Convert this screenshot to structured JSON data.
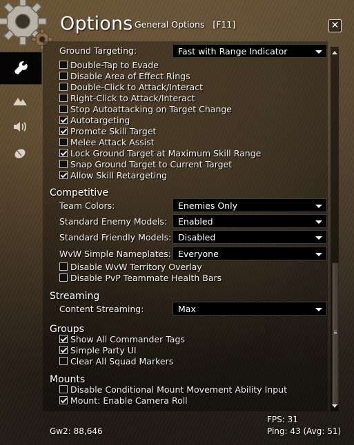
{
  "header": {
    "title": "Options",
    "subtitle": "General Options   [F11]",
    "close_icon": "close-icon"
  },
  "tabs": [
    {
      "icon": "wrench-icon",
      "active": true
    },
    {
      "icon": "mountains-icon",
      "active": false
    },
    {
      "icon": "speaker-icon",
      "active": false
    },
    {
      "icon": "mouse-icon",
      "active": false
    }
  ],
  "ground_targeting": {
    "label": "Ground Targeting:",
    "value": "Fast with Range Indicator"
  },
  "combat_options": [
    {
      "label": "Double-Tap to Evade",
      "checked": false
    },
    {
      "label": "Disable Area of Effect Rings",
      "checked": false
    },
    {
      "label": "Double-Click to Attack/Interact",
      "checked": false
    },
    {
      "label": "Right-Click to Attack/Interact",
      "checked": false
    },
    {
      "label": "Stop Autoattacking on Target Change",
      "checked": false
    },
    {
      "label": "Autotargeting",
      "checked": true
    },
    {
      "label": "Promote Skill Target",
      "checked": true
    },
    {
      "label": "Melee Attack Assist",
      "checked": false
    },
    {
      "label": "Lock Ground Target at Maximum Skill Range",
      "checked": true
    },
    {
      "label": "Snap Ground Target to Current Target",
      "checked": false
    },
    {
      "label": "Allow Skill Retargeting",
      "checked": true
    }
  ],
  "competitive": {
    "heading": "Competitive",
    "dropdowns": [
      {
        "label": "Team Colors:",
        "value": "Enemies Only"
      },
      {
        "label": "Standard Enemy Models:",
        "value": "Enabled"
      },
      {
        "label": "Standard Friendly Models:",
        "value": "Disabled"
      },
      {
        "label": "WvW Simple Nameplates:",
        "value": "Everyone"
      }
    ],
    "checkboxes": [
      {
        "label": "Disable WvW Territory Overlay",
        "checked": false
      },
      {
        "label": "Disable PvP Teammate Health Bars",
        "checked": false
      }
    ]
  },
  "streaming": {
    "heading": "Streaming",
    "dropdown": {
      "label": "Content Streaming:",
      "value": "Max"
    }
  },
  "groups": {
    "heading": "Groups",
    "checkboxes": [
      {
        "label": "Show All Commander Tags",
        "checked": true
      },
      {
        "label": "Simple Party UI",
        "checked": true
      },
      {
        "label": "Clear All Squad Markers",
        "checked": false
      }
    ]
  },
  "mounts": {
    "heading": "Mounts",
    "checkboxes": [
      {
        "label": "Disable Conditional Mount Movement Ability Input",
        "checked": false
      },
      {
        "label": "Mount: Enable Camera Roll",
        "checked": true
      }
    ]
  },
  "footer": {
    "gw2": "Gw2: 88,646",
    "fps": "FPS: 31",
    "ping": "Ping: 43 (Avg: 51)"
  }
}
